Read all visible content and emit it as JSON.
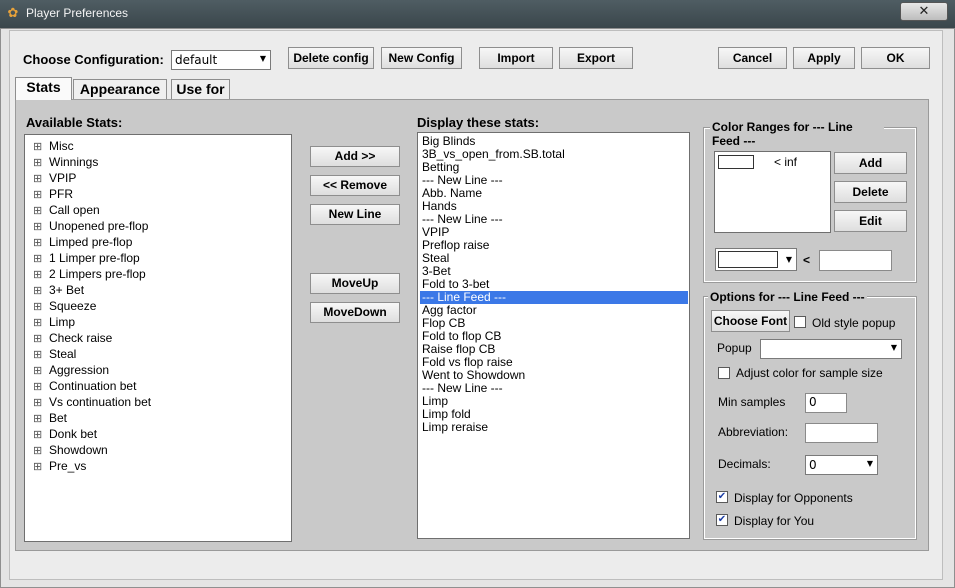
{
  "window": {
    "title": "Player Preferences",
    "close_glyph": "✕",
    "app_icon": "gear-icon"
  },
  "top": {
    "config_label": "Choose Configuration:",
    "config_value": "default",
    "delete_config": "Delete config",
    "new_config": "New Config",
    "import": "Import",
    "export": "Export",
    "cancel": "Cancel",
    "apply": "Apply",
    "ok": "OK"
  },
  "tabs": [
    {
      "label": "Stats",
      "active": true
    },
    {
      "label": "Appearance",
      "active": false
    },
    {
      "label": "Use for",
      "active": false
    }
  ],
  "available": {
    "label": "Available Stats:",
    "items": [
      "Misc",
      "Winnings",
      "VPIP",
      "PFR",
      "Call open",
      "Unopened pre-flop",
      "Limped pre-flop",
      "1 Limper pre-flop",
      "2 Limpers pre-flop",
      "3+ Bet",
      "Squeeze",
      "Limp",
      "Check raise",
      "Steal",
      "Aggression",
      "Continuation bet",
      "Vs continuation bet",
      "Bet",
      "Donk bet",
      "Showdown",
      "Pre_vs"
    ]
  },
  "middle_buttons": {
    "add": "Add >>",
    "remove": "<< Remove",
    "new_line": "New Line",
    "move_up": "MoveUp",
    "move_down": "MoveDown"
  },
  "display": {
    "label": "Display these stats:",
    "items": [
      "Big Blinds",
      "3B_vs_open_from.SB.total",
      "Betting",
      "--- New Line ---",
      "Abb. Name",
      "Hands",
      "--- New Line ---",
      "VPIP",
      "Preflop raise",
      "Steal",
      "3-Bet",
      "Fold to 3-bet",
      "--- Line Feed ---",
      "Agg factor",
      "Flop CB",
      "Fold to flop CB",
      "Raise flop CB",
      "Fold vs flop raise",
      "Went to Showdown",
      "--- New Line ---",
      "Limp",
      "Limp fold",
      "Limp reraise"
    ],
    "selected_index": 12
  },
  "color_ranges": {
    "title": "Color Ranges for --- Line Feed ---",
    "range_text": "< inf",
    "add": "Add",
    "delete": "Delete",
    "edit": "Edit",
    "lt_symbol": "<",
    "swatch_color": "#ffffff"
  },
  "options": {
    "title": "Options for --- Line Feed ---",
    "choose_font": "Choose Font",
    "old_style_popup": "Old style popup",
    "old_style_checked": false,
    "popup_label": "Popup",
    "popup_value": "",
    "adjust_color": "Adjust color for sample size",
    "adjust_checked": false,
    "min_samples_label": "Min samples",
    "min_samples_value": "0",
    "abbreviation_label": "Abbreviation:",
    "abbreviation_value": "",
    "decimals_label": "Decimals:",
    "decimals_value": "0",
    "display_opponents": "Display for Opponents",
    "display_opponents_checked": true,
    "display_you": "Display for You",
    "display_you_checked": true
  }
}
